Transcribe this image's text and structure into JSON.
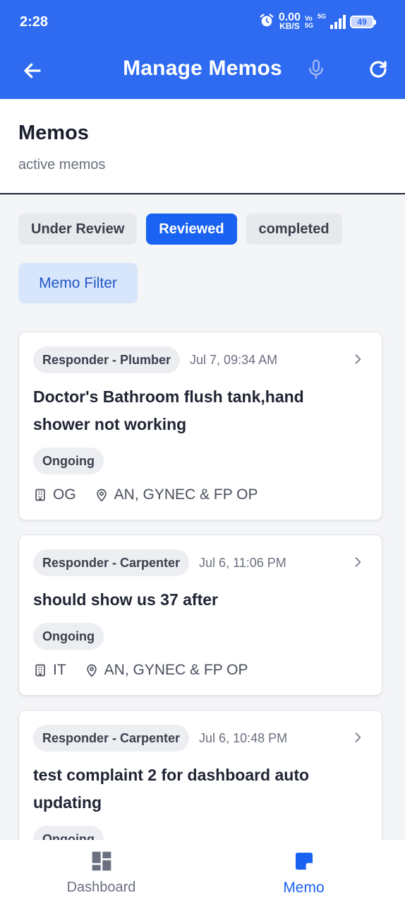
{
  "status_bar": {
    "time": "2:28",
    "speed_value": "0.00",
    "speed_unit": "KB/S",
    "volte_top": "Vo",
    "volte_bottom": "5G",
    "network": "5G",
    "battery": "49"
  },
  "header": {
    "title": "Manage Memos",
    "icons": [
      "back-arrow-icon",
      "microphone-icon",
      "refresh-icon"
    ]
  },
  "section": {
    "title": "Memos",
    "subtitle": "active memos"
  },
  "tabs": [
    {
      "label": "Under Review",
      "active": false
    },
    {
      "label": "Reviewed",
      "active": true
    },
    {
      "label": "completed",
      "active": false
    }
  ],
  "filter_label": "Memo Filter",
  "memos": [
    {
      "responder": "Responder - Plumber",
      "date": "Jul 7, 09:34 AM",
      "title": "Doctor's Bathroom flush tank,hand shower not working",
      "status": "Ongoing",
      "building": "OG",
      "location": "AN, GYNEC & FP OP"
    },
    {
      "responder": "Responder - Carpenter",
      "date": "Jul 6, 11:06 PM",
      "title": "should show us 37 after",
      "status": "Ongoing",
      "building": "IT",
      "location": "AN, GYNEC & FP OP"
    },
    {
      "responder": "Responder - Carpenter",
      "date": "Jul 6, 10:48 PM",
      "title": "test complaint 2 for dashboard auto updating",
      "status": "Ongoing"
    }
  ],
  "bottom_nav": [
    {
      "label": "Dashboard",
      "icon": "dashboard-icon",
      "active": false
    },
    {
      "label": "Memo",
      "icon": "memo-icon",
      "active": true
    }
  ],
  "colors": {
    "primary": "#2f6bf0",
    "tab_active": "#1a62f2",
    "filter_bg": "#d8e6fb",
    "chip_bg": "#eceef1"
  }
}
